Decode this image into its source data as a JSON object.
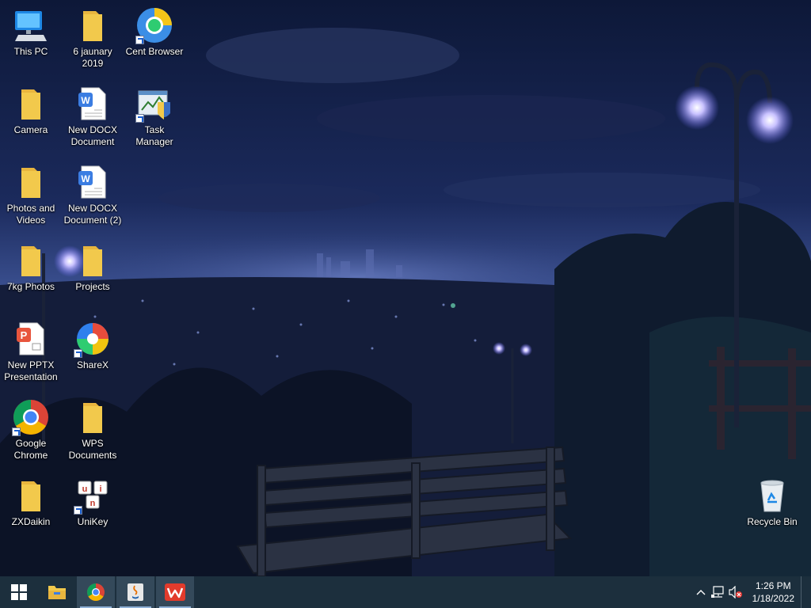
{
  "desktop": {
    "icons": [
      {
        "id": "this-pc",
        "label": "This PC",
        "icon": "computer-icon"
      },
      {
        "id": "6-jaunary-2019",
        "label": "6 jaunary 2019",
        "icon": "folder-icon"
      },
      {
        "id": "cent-browser",
        "label": "Cent Browser",
        "icon": "cent-browser-icon"
      },
      {
        "id": "camera",
        "label": "Camera",
        "icon": "folder-icon"
      },
      {
        "id": "new-docx",
        "label": "New DOCX Document",
        "icon": "word-document-icon"
      },
      {
        "id": "task-manager",
        "label": "Task Manager",
        "icon": "task-manager-icon"
      },
      {
        "id": "photos-and-videos",
        "label": "Photos and Videos",
        "icon": "folder-icon"
      },
      {
        "id": "new-docx-2",
        "label": "New DOCX Document (2)",
        "icon": "word-document-icon"
      },
      {
        "id": "7kg-photos",
        "label": "7kg Photos",
        "icon": "folder-icon"
      },
      {
        "id": "projects",
        "label": "Projects",
        "icon": "folder-icon"
      },
      {
        "id": "new-pptx",
        "label": "New PPTX Presentation",
        "icon": "powerpoint-icon"
      },
      {
        "id": "sharex",
        "label": "ShareX",
        "icon": "sharex-icon"
      },
      {
        "id": "google-chrome",
        "label": "Google Chrome",
        "icon": "chrome-icon"
      },
      {
        "id": "wps-documents",
        "label": "WPS Documents",
        "icon": "folder-icon"
      },
      {
        "id": "zxdaikin",
        "label": "ZXDaikin",
        "icon": "folder-icon"
      },
      {
        "id": "unikey",
        "label": "UniKey",
        "icon": "unikey-icon"
      },
      {
        "id": "recycle-bin",
        "label": "Recycle Bin",
        "icon": "recycle-bin-icon"
      }
    ]
  },
  "taskbar": {
    "start": "windows-start-icon",
    "pinned": [
      "file-explorer-icon",
      "chrome-icon",
      "java-icon",
      "wps-office-icon"
    ],
    "tray": [
      "chevron-up-icon",
      "network-icon",
      "volume-muted-icon"
    ],
    "clock": {
      "time": "1:26 PM",
      "date": "1/18/2022"
    }
  },
  "colors": {
    "taskbar": "#1c2f3d",
    "folder": "#f2c94c",
    "sky": "#1b2a5c"
  }
}
